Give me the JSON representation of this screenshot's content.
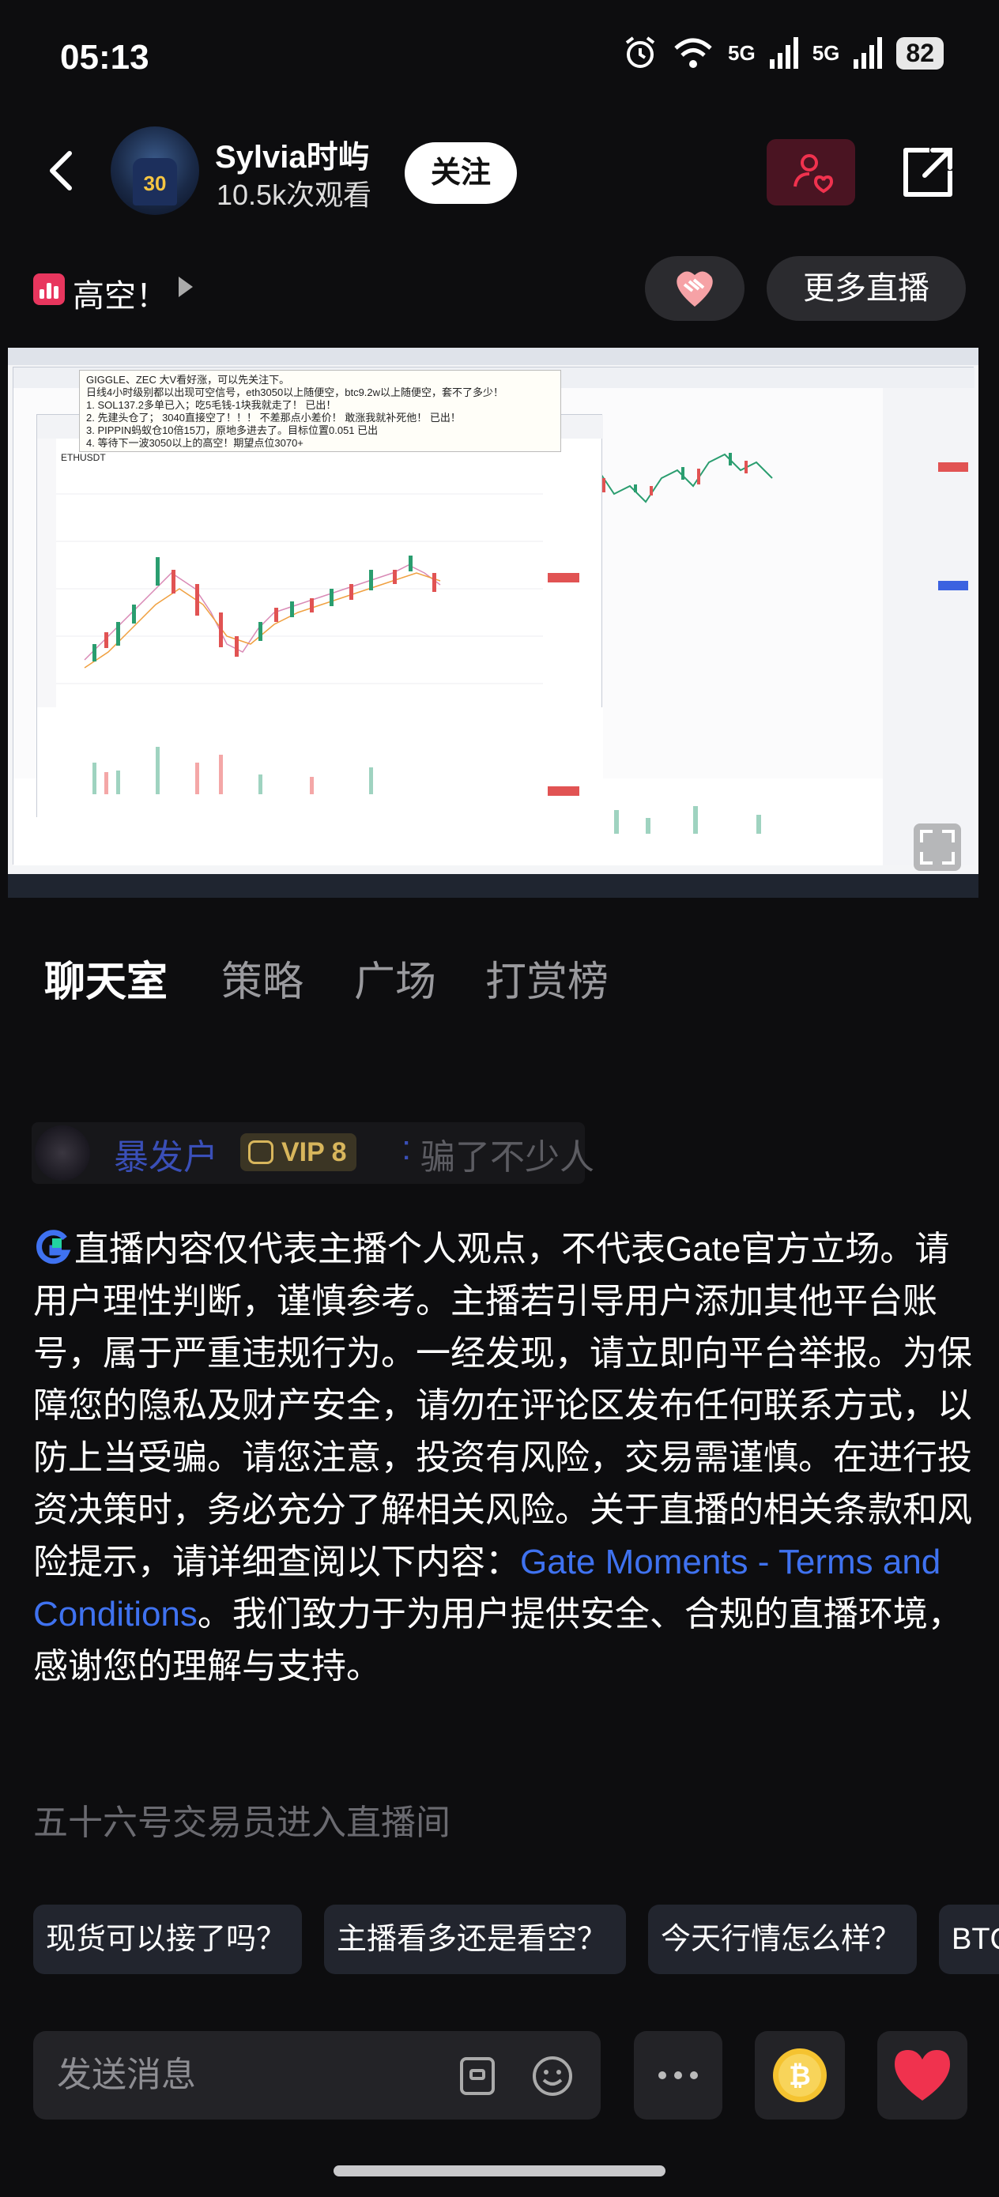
{
  "status_bar": {
    "time": "05:13",
    "network_1": "5G",
    "network_2": "5G",
    "battery": "82"
  },
  "header": {
    "host_name": "Sylvia时屿",
    "views": "10.5k次观看",
    "follow_label": "关注",
    "avatar_jersey_number": "30"
  },
  "subbar": {
    "topic": "高空！",
    "more_live_label": "更多直播"
  },
  "video": {
    "pinned_note": [
      "GIGGLE、ZEC 大V看好涨，可以先关注下。",
      "日线4小时级别都以出现可空信号，eth3050以上随便空，btc9.2w以上随便空，套不了多少！",
      "1. SOL137.2多单已入；吃5毛钱-1块我就走了！ 已出！",
      "2. 先建头仓了； 3040直接空了！！！ 不差那点小差价！ 敢涨我就补死他！ 已出！",
      "3. PIPPIN蚂蚁仓10倍15刀，原地多进去了。目标位置0.051 已出",
      "4. 等待下一波3050以上的高空！期望点位3070+"
    ],
    "symbol": "ETHUSDT"
  },
  "tabs": [
    {
      "label": "聊天室",
      "active": true
    },
    {
      "label": "策略",
      "active": false
    },
    {
      "label": "广场",
      "active": false
    },
    {
      "label": "打赏榜",
      "active": false
    }
  ],
  "chat": {
    "user": "暴发户",
    "vip": "VIP 8",
    "colon": ":",
    "message": "骗了不少人"
  },
  "notice": {
    "text_before_link": "直播内容仅代表主播个人观点，不代表Gate官方立场。请用户理性判断，谨慎参考。主播若引导用户添加其他平台账号，属于严重违规行为。一经发现，请立即向平台举报。为保障您的隐私及财产安全，请勿在评论区发布任何联系方式，以防上当受骗。请您注意，投资有风险，交易需谨慎。在进行投资决策时，务必充分了解相关风险。关于直播的相关条款和风险提示，请详细查阅以下内容：",
    "link_text": "Gate Moments - Terms and Conditions",
    "text_after_link": "。我们致力于为用户提供安全、合规的直播环境，感谢您的理解与支持。"
  },
  "enter_message": "五十六号交易员进入直播间",
  "quick_replies": [
    "现货可以接了吗？",
    "主播看多还是看空？",
    "今天行情怎么样？",
    "BTC"
  ],
  "input": {
    "placeholder": "发送消息"
  },
  "colors": {
    "background": "#0d0d0f",
    "link": "#3f72f0",
    "chat_user": "#3a4fb8",
    "vip_gold": "#d8b65c",
    "heart": "#f0324e"
  }
}
